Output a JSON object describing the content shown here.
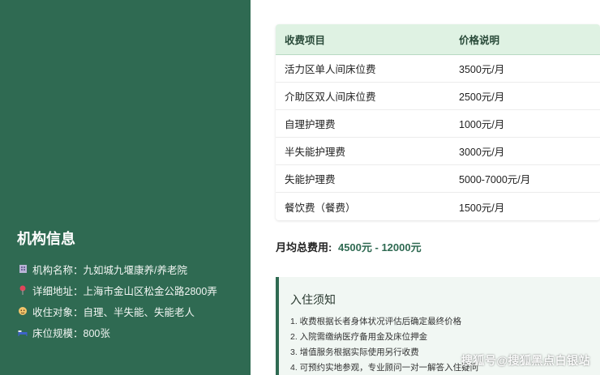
{
  "sidebar": {
    "title": "机构信息",
    "items": [
      {
        "icon": "building-icon",
        "label": "机构名称：",
        "value": "九如城九堰康养/养老院"
      },
      {
        "icon": "location-pin-icon",
        "label": "详细地址：",
        "value": "上海市金山区松金公路2800弄"
      },
      {
        "icon": "elder-face-icon",
        "label": "收住对象：",
        "value": "自理、半失能、失能老人"
      },
      {
        "icon": "bed-icon",
        "label": "床位规模：",
        "value": "800张"
      }
    ]
  },
  "fees": {
    "headers": [
      "收费项目",
      "价格说明"
    ],
    "rows": [
      [
        "活力区单人间床位费",
        "3500元/月"
      ],
      [
        "介助区双人间床位费",
        "2500元/月"
      ],
      [
        "自理护理费",
        "1000元/月"
      ],
      [
        "半失能护理费",
        "3000元/月"
      ],
      [
        "失能护理费",
        "5000-7000元/月"
      ],
      [
        "餐饮费（餐费）",
        "1500元/月"
      ]
    ],
    "total_label": "月均总费用:",
    "total_value": "4500元 - 12000元"
  },
  "notice": {
    "title": "入住须知",
    "items": [
      "1. 收费根据长者身体状况评估后确定最终价格",
      "2. 入院需缴纳医疗备用金及床位押金",
      "3. 增值服务根据实际使用另行收费",
      "4. 可预约实地参观，专业顾问一对一解答入住疑问"
    ]
  },
  "watermark": "搜狐号@搜狐黑点白银站",
  "colors": {
    "sidebar_bg": "#2f6a52",
    "table_header_bg": "#dff2e3",
    "accent": "#2f6a52"
  }
}
